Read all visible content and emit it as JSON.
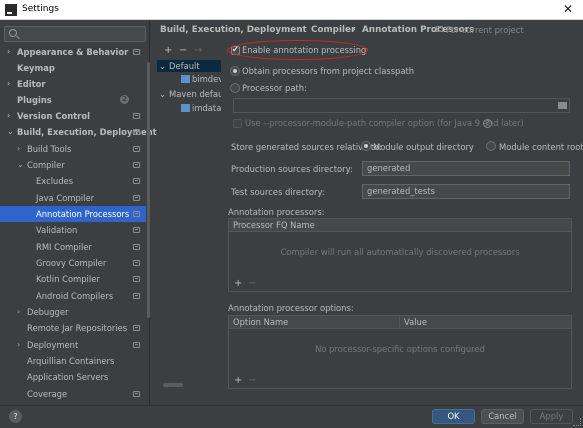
{
  "window": {
    "title": "Settings",
    "close_glyph": "✕"
  },
  "search": {
    "placeholder": ""
  },
  "sidebar": {
    "items": [
      {
        "label": "Appearance & Behavior",
        "arrow": "›",
        "bold": true
      },
      {
        "label": "Keymap",
        "bold": true
      },
      {
        "label": "Editor",
        "arrow": "›",
        "bold": true
      },
      {
        "label": "Plugins",
        "bold": true,
        "badge": "2"
      },
      {
        "label": "Version Control",
        "arrow": "›",
        "bold": true
      },
      {
        "label": "Build, Execution, Deployment",
        "arrow": "⌄",
        "bold": true
      },
      {
        "label": "Build Tools",
        "arrow": "›"
      },
      {
        "label": "Compiler",
        "arrow": "⌄"
      },
      {
        "label": "Excludes"
      },
      {
        "label": "Java Compiler"
      },
      {
        "label": "Annotation Processors",
        "selected": true
      },
      {
        "label": "Validation"
      },
      {
        "label": "RMI Compiler"
      },
      {
        "label": "Groovy Compiler"
      },
      {
        "label": "Kotlin Compiler"
      },
      {
        "label": "Android Compilers"
      },
      {
        "label": "Debugger",
        "arrow": "›"
      },
      {
        "label": "Remote Jar Repositories"
      },
      {
        "label": "Deployment",
        "arrow": "›"
      },
      {
        "label": "Arquillian Containers"
      },
      {
        "label": "Application Servers"
      },
      {
        "label": "Coverage"
      }
    ]
  },
  "breadcrumb": {
    "part1": "Build, Execution, Deployment",
    "sep": "›",
    "part2": "Compiler",
    "part3": "Annotation Processors",
    "scope": "For current project"
  },
  "profiles": {
    "toolbar": {
      "add": "+",
      "remove": "−",
      "move": "→"
    },
    "items": [
      {
        "label": "Default",
        "arrow": "⌄"
      },
      {
        "label": "bimdev"
      },
      {
        "label": "Maven default",
        "arrow": "⌄"
      },
      {
        "label": "imdatas"
      }
    ]
  },
  "options": {
    "enable_label": "Enable annotation processing",
    "obtain_label": "Obtain processors from project classpath",
    "path_label": "Processor path:",
    "module_path_label": "Use --processor-module-path compiler option (for Java 9 and later)",
    "help_glyph": "?",
    "store_label": "Store generated sources relative to:",
    "module_output_label": "Module output directory",
    "module_content_label": "Module content root",
    "prod_dir_label": "Production sources directory:",
    "prod_dir_value": "generated",
    "test_dir_label": "Test sources directory:",
    "test_dir_value": "generated_tests"
  },
  "processors": {
    "section_label": "Annotation processors:",
    "column": "Processor FQ Name",
    "empty": "Compiler will run all automatically discovered processors",
    "add": "+",
    "remove": "−"
  },
  "processor_options": {
    "section_label": "Annotation processor options:",
    "col_name": "Option Name",
    "col_value": "Value",
    "empty": "No processor-specific options configured",
    "add": "+",
    "remove": "−"
  },
  "buttons": {
    "help": "?",
    "ok": "OK",
    "cancel": "Cancel",
    "apply": "Apply"
  },
  "colors": {
    "selection": "#2f65ca",
    "ok_button": "#365880",
    "highlight_ellipse": "#e02020"
  }
}
